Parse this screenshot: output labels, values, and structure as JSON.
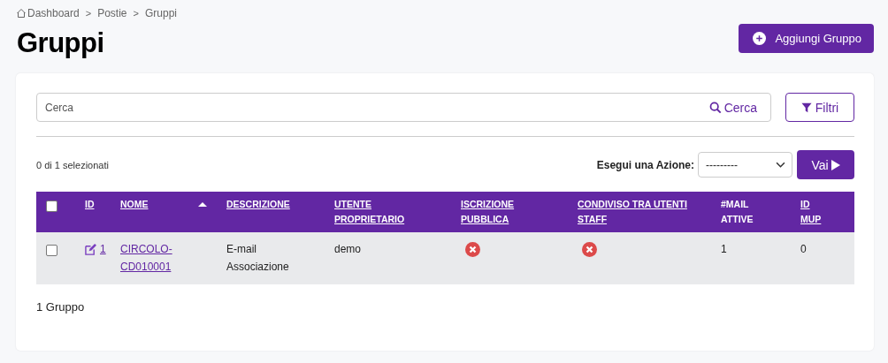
{
  "breadcrumb": [
    "Dashboard",
    "Postie",
    "Gruppi"
  ],
  "breadcrumb_separator": ">",
  "title": "Gruppi",
  "add_button": "Aggiungi Gruppo",
  "search": {
    "placeholder": "Cerca",
    "button": "Cerca"
  },
  "filter_button": "Filtri",
  "selection_count": "0 di 1 selezionati",
  "action": {
    "label": "Esegui una Azione:",
    "value": "---------",
    "button": "Vai"
  },
  "table": {
    "select_all": false,
    "columns": [
      {
        "label": "ID",
        "link": true,
        "sorted": false
      },
      {
        "label": "NOME",
        "link": true,
        "sorted": true
      },
      {
        "label": "DESCRIZIONE",
        "link": true,
        "sorted": false
      },
      {
        "label": "UTENTE PROPRIETARIO",
        "link": true,
        "sorted": false
      },
      {
        "label": "ISCRIZIONE PUBBLICA",
        "link": true,
        "sorted": false
      },
      {
        "label": "CONDIVISO TRA UTENTI STAFF",
        "link": true,
        "sorted": false
      },
      {
        "label": "#MAIL ATTIVE",
        "link": false,
        "sorted": false
      },
      {
        "label": "ID MUP",
        "link": true,
        "sorted": false
      }
    ],
    "rows": [
      {
        "checked": false,
        "id": "1",
        "name": "CIRCOLO-CD010001",
        "description": "E-mail Associazione",
        "owner": "demo",
        "public_signup": false,
        "shared_staff": false,
        "active_mails": "1",
        "mup_id": "0"
      }
    ]
  },
  "footer": "1 Gruppo"
}
